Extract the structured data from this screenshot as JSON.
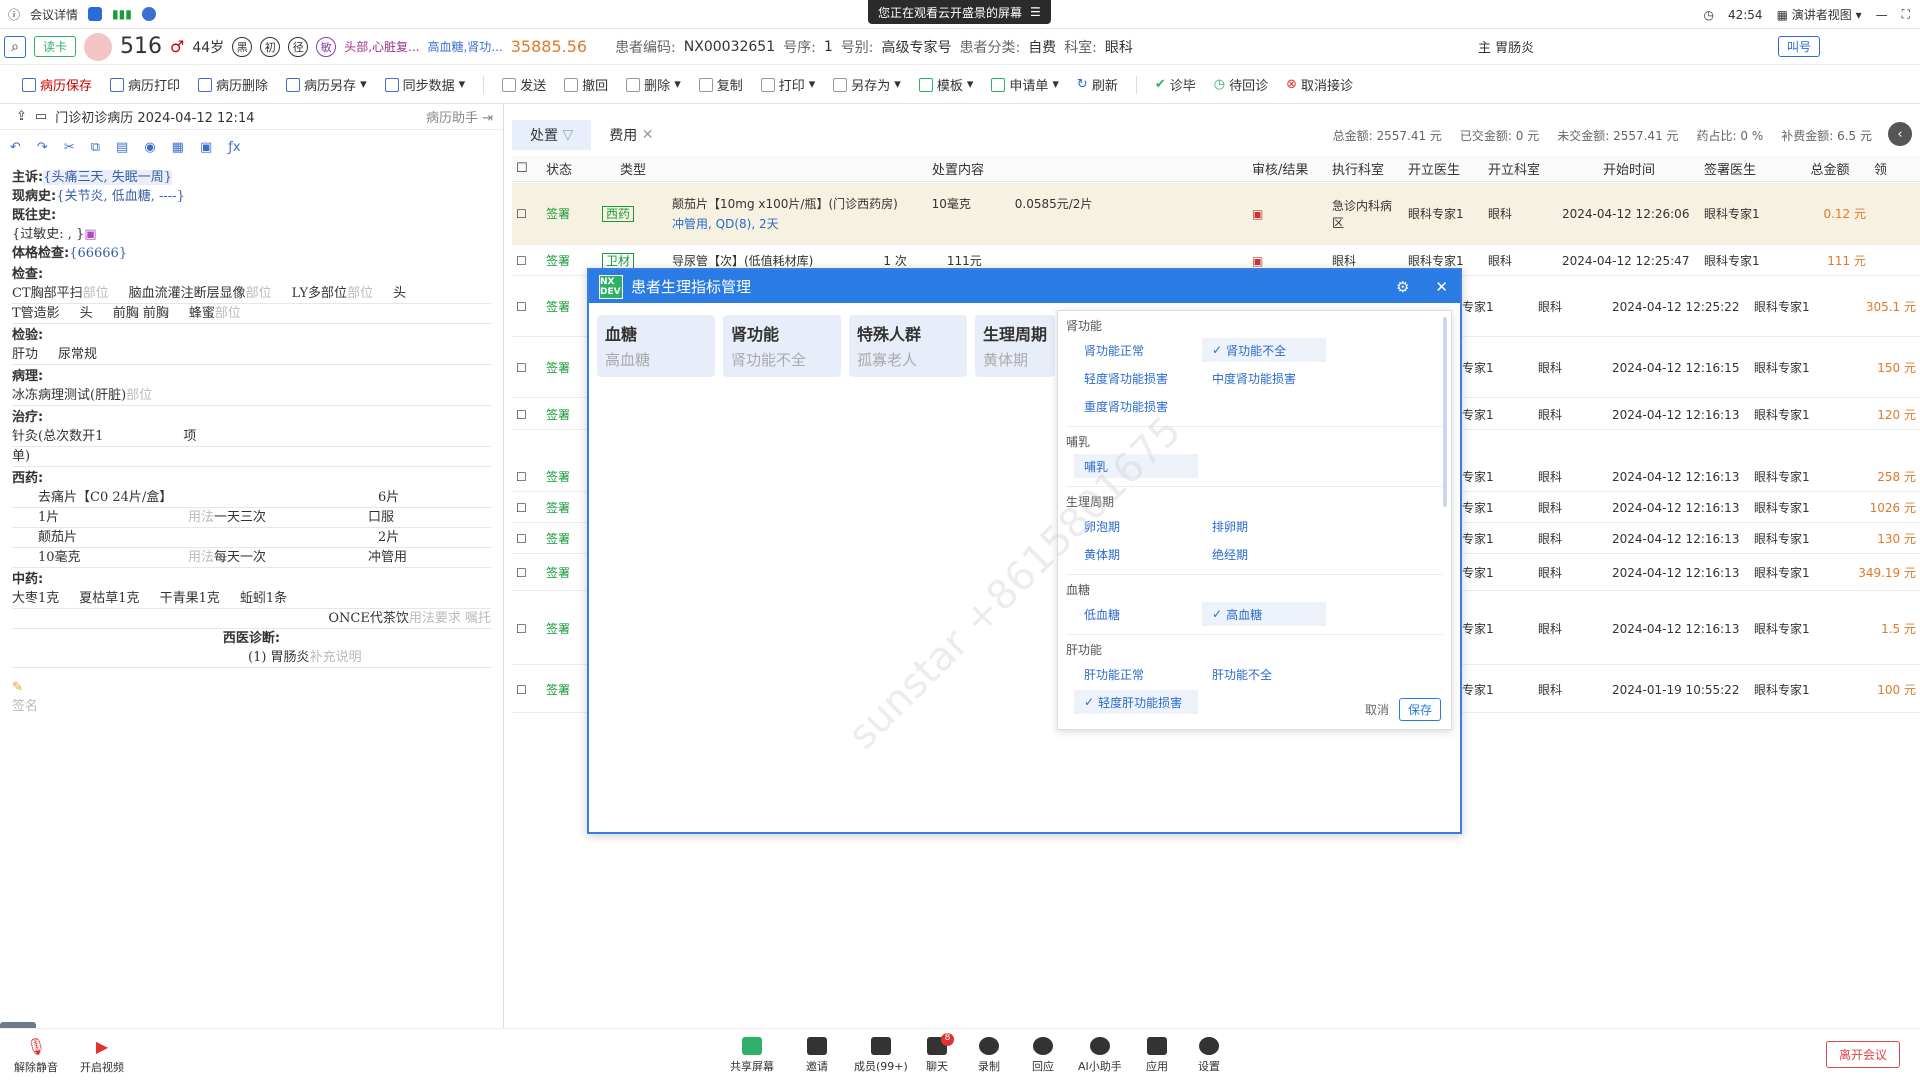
{
  "topbar": {
    "meeting": "会议详情",
    "banner": "您正在观看云开盛景的屏幕",
    "time": "42:54",
    "view": "演讲者视图"
  },
  "patient": {
    "search_placeholder": "",
    "read_btn": "读卡",
    "age_num": "516",
    "age": "44岁",
    "tags": [
      "黑",
      "初",
      "径",
      "敏"
    ],
    "diag_short": "头部,心脏复...",
    "phys_short": "高血糖,肾功...",
    "balance": "35885.56",
    "code_label": "患者编码:",
    "code": "NX00032651",
    "seq_label": "号序:",
    "seq": "1",
    "reg_label": "号别:",
    "reg": "高级专家号",
    "type_label": "患者分类:",
    "type": "自费",
    "dept_label": "科室:",
    "dept": "眼科",
    "main_diag": "主 胃肠炎",
    "call_btn": "叫号"
  },
  "toolbar": {
    "items": [
      "病历保存",
      "病历打印",
      "病历删除",
      "病历另存",
      "同步数据",
      "发送",
      "撤回",
      "删除",
      "复制",
      "打印",
      "另存为",
      "模板",
      "申请单",
      "刷新",
      "诊毕",
      "待回诊",
      "取消接诊"
    ]
  },
  "left": {
    "title": "门诊初诊病历 2024-04-12 12:14",
    "assistant": "病历助手",
    "chief_label": "主诉:",
    "chief": "{头痛三天, 失眠一周}",
    "present_label": "现病史:",
    "present": "{关节炎, 低血糖, ----}",
    "past_label": "既往史:",
    "allergy": "{过敏史:   , }",
    "exam_label": "体格检查:",
    "exam": "{66666}",
    "check_label": "检查:",
    "check1": "CT胸部平扫",
    "check1_ph": "部位",
    "check2": "脑血流灌注断层显像",
    "check2_ph": "部位",
    "check3": "LY多部位",
    "check3_ph": "部位",
    "check4": "头",
    "check5": "T管造影",
    "check6": "头",
    "check7": "前胸 前胸",
    "check8": "蜂蜜",
    "check8_ph": "部位",
    "lab_label": "检验:",
    "lab1": "肝功",
    "lab2": "尿常规",
    "path_label": "病理:",
    "path1": "冰冻病理测试(肝脏)",
    "path1_ph": "部位",
    "treat_label": "治疗:",
    "treat1": "针灸(总次数开1",
    "treat1b": "项",
    "treat1c": "单)",
    "west_label": "西药:",
    "w1": "去痛片【C0 24片/盒】",
    "w1q": "6片",
    "w2": "1片",
    "w2u_ph": "用法",
    "w2u": "一天三次",
    "w2r": "口服",
    "w3": "颠茄片",
    "w3q": "2片",
    "w4": "10毫克",
    "w4u_ph": "用法",
    "w4u": "每天一次",
    "w4r": "冲管用",
    "cn_label": "中药:",
    "c1": "大枣1克",
    "c2": "夏枯草1克",
    "c3": "干青果1克",
    "c4": "蚯蚓1条",
    "c5": "ONCE代茶饮",
    "c5_ph": "用法要求 嘱托",
    "wdiag_label": "西医诊断:",
    "wdiag": "(1) 胃肠炎",
    "wdiag_ph": "补充说明",
    "sign": "签名"
  },
  "tabs": {
    "t1": "处置",
    "t2": "费用"
  },
  "summary": {
    "total": "总金额: 2557.41 元",
    "paid": "已交金额: 0 元",
    "unpaid": "未交金额: 2557.41 元",
    "ratio": "药占比: 0 %",
    "sub": "补费金额: 6.5 元"
  },
  "thead": [
    "状态",
    "类型",
    "处置内容",
    "审核/结果",
    "执行科室",
    "开立医生",
    "开立科室",
    "开始时间",
    "签署医生",
    "总金额",
    "领"
  ],
  "rows": [
    {
      "status": "签署",
      "type": "西药",
      "content": "颠茄片【10mg x100片/瓶】(门诊西药房)",
      "qty": "10毫克",
      "unit": "0.0585元/2片",
      "sub": "冲管用, QD(8), 2天",
      "exec": "急诊内科病区",
      "doc": "眼科专家1",
      "dept": "眼科",
      "time": "2024-04-12 12:26:06",
      "signer": "眼科专家1",
      "amt": "0.12 元"
    },
    {
      "status": "签署",
      "type": "卫材",
      "content": "导尿管【次】(低值耗材库)",
      "qty": "1 次",
      "unit": "111元",
      "sub": "",
      "exec": "眼科",
      "doc": "眼科专家1",
      "dept": "眼科",
      "time": "2024-04-12 12:25:47",
      "signer": "眼科专家1",
      "amt": "111 元"
    },
    {
      "status": "签署",
      "doc": "专家1",
      "dept": "眼科",
      "time": "2024-04-12 12:25:22",
      "signer": "眼科专家1",
      "amt": "305.1 元"
    },
    {
      "status": "签署",
      "doc": "专家1",
      "dept": "眼科",
      "time": "2024-04-12 12:16:15",
      "signer": "眼科专家1",
      "amt": "150 元"
    },
    {
      "status": "签署",
      "doc": "专家1",
      "dept": "眼科",
      "time": "2024-04-12 12:16:13",
      "signer": "眼科专家1",
      "amt": "120 元"
    },
    {
      "status": "签署",
      "doc": "专家1",
      "dept": "眼科",
      "time": "2024-04-12 12:16:13",
      "signer": "眼科专家1",
      "amt": "258 元"
    },
    {
      "status": "签署",
      "doc": "专家1",
      "dept": "眼科",
      "time": "2024-04-12 12:16:13",
      "signer": "眼科专家1",
      "amt": "1026 元"
    },
    {
      "status": "签署",
      "doc": "专家1",
      "dept": "眼科",
      "time": "2024-04-12 12:16:13",
      "signer": "眼科专家1",
      "amt": "130 元"
    },
    {
      "status": "签署",
      "doc": "专家1",
      "dept": "眼科",
      "time": "2024-04-12 12:16:13",
      "signer": "眼科专家1",
      "amt": "349.19 元"
    },
    {
      "status": "签署",
      "doc": "专家1",
      "dept": "眼科",
      "time": "2024-04-12 12:16:13",
      "signer": "眼科专家1",
      "amt": "1.5 元"
    },
    {
      "status": "签署",
      "doc": "专家1",
      "dept": "眼科",
      "time": "2024-01-19 10:55:22",
      "signer": "眼科专家1",
      "amt": "100 元"
    }
  ],
  "modal": {
    "logo": "NX DEV",
    "title": "患者生理指标管理",
    "cards": [
      {
        "t": "血糖",
        "v": "高血糖"
      },
      {
        "t": "肾功能",
        "v": "肾功能不全"
      },
      {
        "t": "特殊人群",
        "v": "孤寡老人"
      },
      {
        "t": "生理周期",
        "v": "黄体期"
      }
    ],
    "groups": [
      {
        "name": "肾功能",
        "opts": [
          "肾功能正常",
          "肾功能不全",
          "轻度肾功能损害",
          "中度肾功能损害",
          "重度肾功能损害"
        ]
      },
      {
        "name": "哺乳",
        "opts": [
          "哺乳"
        ]
      },
      {
        "name": "生理周期",
        "opts": [
          "卵泡期",
          "排卵期",
          "黄体期",
          "绝经期"
        ]
      },
      {
        "name": "血糖",
        "opts": [
          "低血糖",
          "高血糖"
        ]
      },
      {
        "name": "肝功能",
        "opts": [
          "肝功能正常",
          "肝功能不全",
          "轻度肝功能损害"
        ]
      }
    ],
    "cancel": "取消",
    "save": "保存"
  },
  "watermark": "sunstar +8615801675",
  "bottom": {
    "mute": "解除静音",
    "video": "开启视频",
    "share": "共享屏幕",
    "invite": "邀请",
    "members": "成员(99+)",
    "chat": "聊天",
    "chat_badge": "8",
    "record": "录制",
    "reply": "回应",
    "ai": "AI小助手",
    "apps": "应用",
    "settings": "设置",
    "leave": "离开会议"
  }
}
